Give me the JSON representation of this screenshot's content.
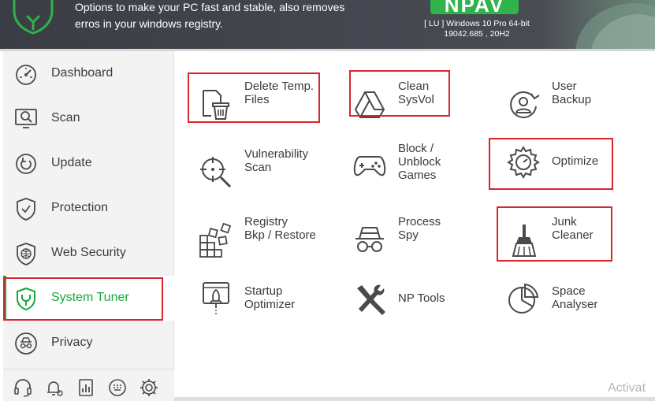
{
  "header": {
    "description_line1": "Options to make your PC fast and stable, also removes",
    "description_line2": "erros in your windows registry.",
    "brand": "NPAV",
    "os_line1": "[ LU ] Windows 10 Pro 64-bit",
    "os_line2": "19042.685 , 20H2"
  },
  "sidebar": {
    "items": [
      {
        "label": "Dashboard",
        "icon": "speedometer-icon"
      },
      {
        "label": "Scan",
        "icon": "monitor-search-icon"
      },
      {
        "label": "Update",
        "icon": "update-icon"
      },
      {
        "label": "Protection",
        "icon": "shield-check-icon"
      },
      {
        "label": "Web Security",
        "icon": "shield-globe-icon"
      },
      {
        "label": "System Tuner",
        "icon": "shield-tuner-icon"
      },
      {
        "label": "Privacy",
        "icon": "spy-icon"
      }
    ],
    "active": "System Tuner",
    "bottom_icons": [
      "headset-icon",
      "bell-gear-icon",
      "report-icon",
      "keyboard-icon",
      "settings-icon"
    ]
  },
  "tools": [
    {
      "label": "Delete Temp.\nFiles",
      "icon": "delete-temp-icon"
    },
    {
      "label": "Clean\nSysVol",
      "icon": "drive-icon"
    },
    {
      "label": "User\nBackup",
      "icon": "user-backup-icon"
    },
    {
      "label": "Vulnerability\nScan",
      "icon": "crosshair-search-icon"
    },
    {
      "label": "Block /\nUnblock\nGames",
      "icon": "gamepad-icon"
    },
    {
      "label": "Optimize",
      "icon": "gear-gauge-icon"
    },
    {
      "label": "Registry\nBkp / Restore",
      "icon": "registry-blocks-icon"
    },
    {
      "label": "Process\nSpy",
      "icon": "spy-glasses-icon"
    },
    {
      "label": "Junk\nCleaner",
      "icon": "broom-icon"
    },
    {
      "label": "Startup\nOptimizer",
      "icon": "startup-rocket-icon"
    },
    {
      "label": "NP Tools",
      "icon": "tools-icon"
    },
    {
      "label": "Space\nAnalyser",
      "icon": "pie-chart-icon"
    }
  ],
  "watermark": "Activat",
  "colors": {
    "accent": "#17a93b",
    "highlight_box": "#d7262f",
    "header_bg": "#3f4249"
  }
}
